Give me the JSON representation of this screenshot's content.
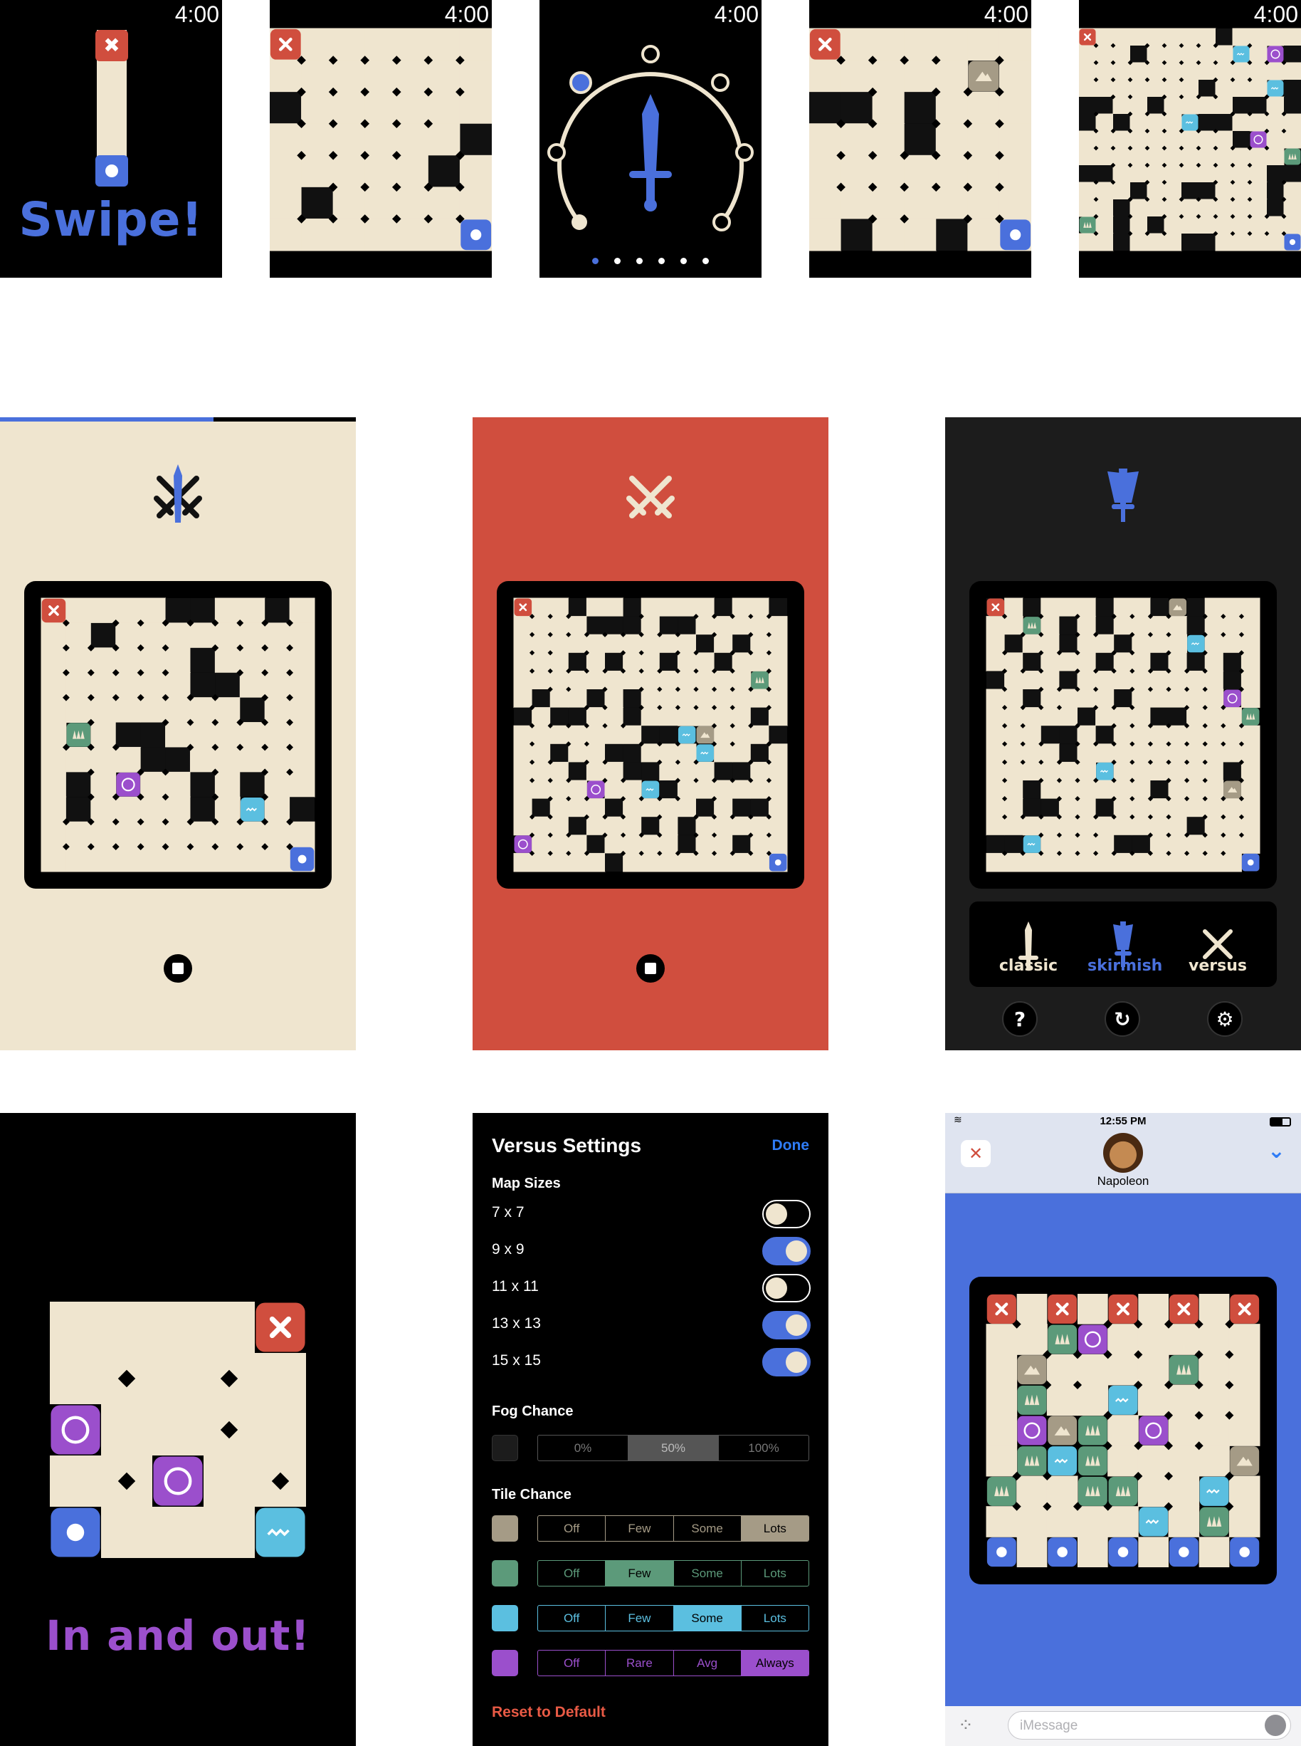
{
  "watch": {
    "time": "4:00",
    "swipe_text": "Swipe!",
    "page_dots": 6,
    "page_dot_active": 0
  },
  "phone_tutorial": {
    "text": "In and out!"
  },
  "phone_skirmish": {
    "modes": [
      "classic",
      "skirmish",
      "versus"
    ],
    "selected_mode": "skirmish"
  },
  "settings": {
    "title": "Versus Settings",
    "done_label": "Done",
    "map_sizes_header": "Map Sizes",
    "map_sizes": [
      {
        "label": "7 x 7",
        "on": false
      },
      {
        "label": "9 x 9",
        "on": true
      },
      {
        "label": "11 x 11",
        "on": false
      },
      {
        "label": "13 x 13",
        "on": true
      },
      {
        "label": "15 x 15",
        "on": true
      }
    ],
    "fog_header": "Fog Chance",
    "fog_options": [
      "0%",
      "50%",
      "100%"
    ],
    "fog_selected": "50%",
    "tile_header": "Tile Chance",
    "tile_rows": [
      {
        "icon": "mountain-icon",
        "options": [
          "Off",
          "Few",
          "Some",
          "Lots"
        ],
        "selected": "Lots"
      },
      {
        "icon": "forest-icon",
        "options": [
          "Off",
          "Few",
          "Some",
          "Lots"
        ],
        "selected": "Few"
      },
      {
        "icon": "water-icon",
        "options": [
          "Off",
          "Few",
          "Some",
          "Lots"
        ],
        "selected": "Some"
      },
      {
        "icon": "portal-icon",
        "options": [
          "Off",
          "Rare",
          "Avg",
          "Always"
        ],
        "selected": "Always"
      }
    ],
    "reset_label": "Reset to Default"
  },
  "imessage": {
    "status_time": "12:55 PM",
    "contact_name": "Napoleon",
    "input_placeholder": "iMessage"
  },
  "colors": {
    "cream": "#efe5cf",
    "red": "#d04e3e",
    "blue": "#4a70dc",
    "green": "#5c9a7a",
    "tan": "#a59b86",
    "cyan": "#5bbfe0",
    "purple": "#9b4fcc",
    "panel_dark": "#1c1c1c"
  }
}
